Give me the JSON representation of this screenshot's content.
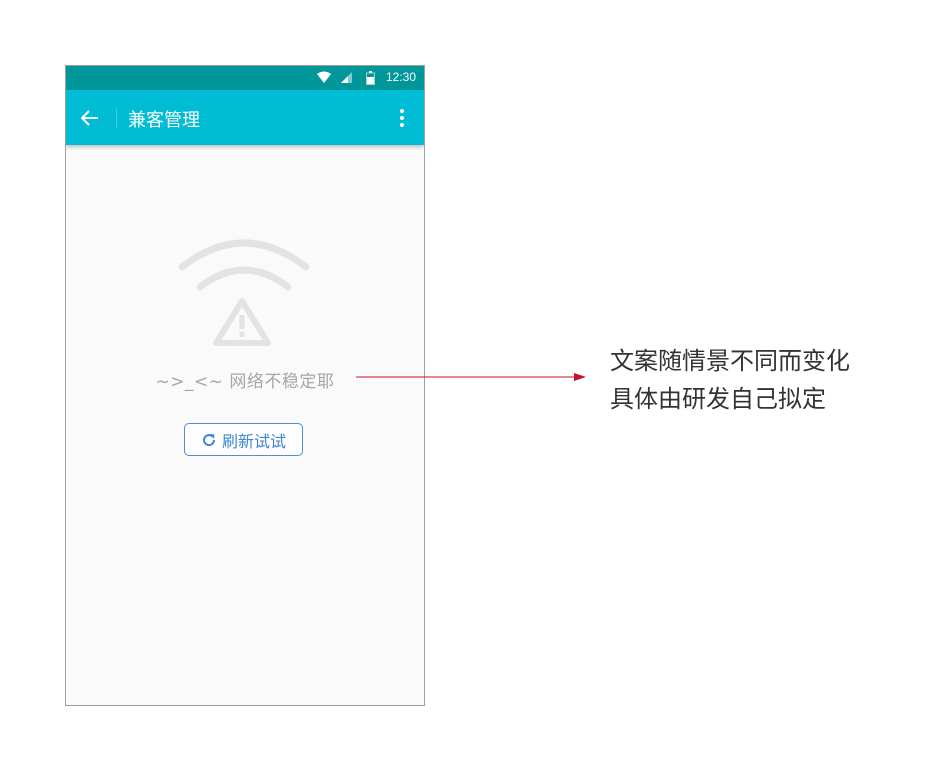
{
  "status_bar": {
    "time": "12:30"
  },
  "app_bar": {
    "title": "兼客管理"
  },
  "empty_state": {
    "message": "~>_<~  网络不稳定耶",
    "refresh_label": "刷新试试"
  },
  "annotation": {
    "line1": "文案随情景不同而变化",
    "line2": "具体由研发自己拟定"
  },
  "icons": {
    "back": "arrow-left-icon",
    "menu": "more-vert-icon",
    "wifi": "wifi-icon",
    "signal": "signal-icon",
    "battery": "battery-icon",
    "network_error": "wifi-warning-icon",
    "refresh": "refresh-icon"
  },
  "colors": {
    "status_bar": "#00979b",
    "app_bar": "#00bcd4",
    "accent": "#3d86d6",
    "annotation_arrow": "#c4132c"
  }
}
